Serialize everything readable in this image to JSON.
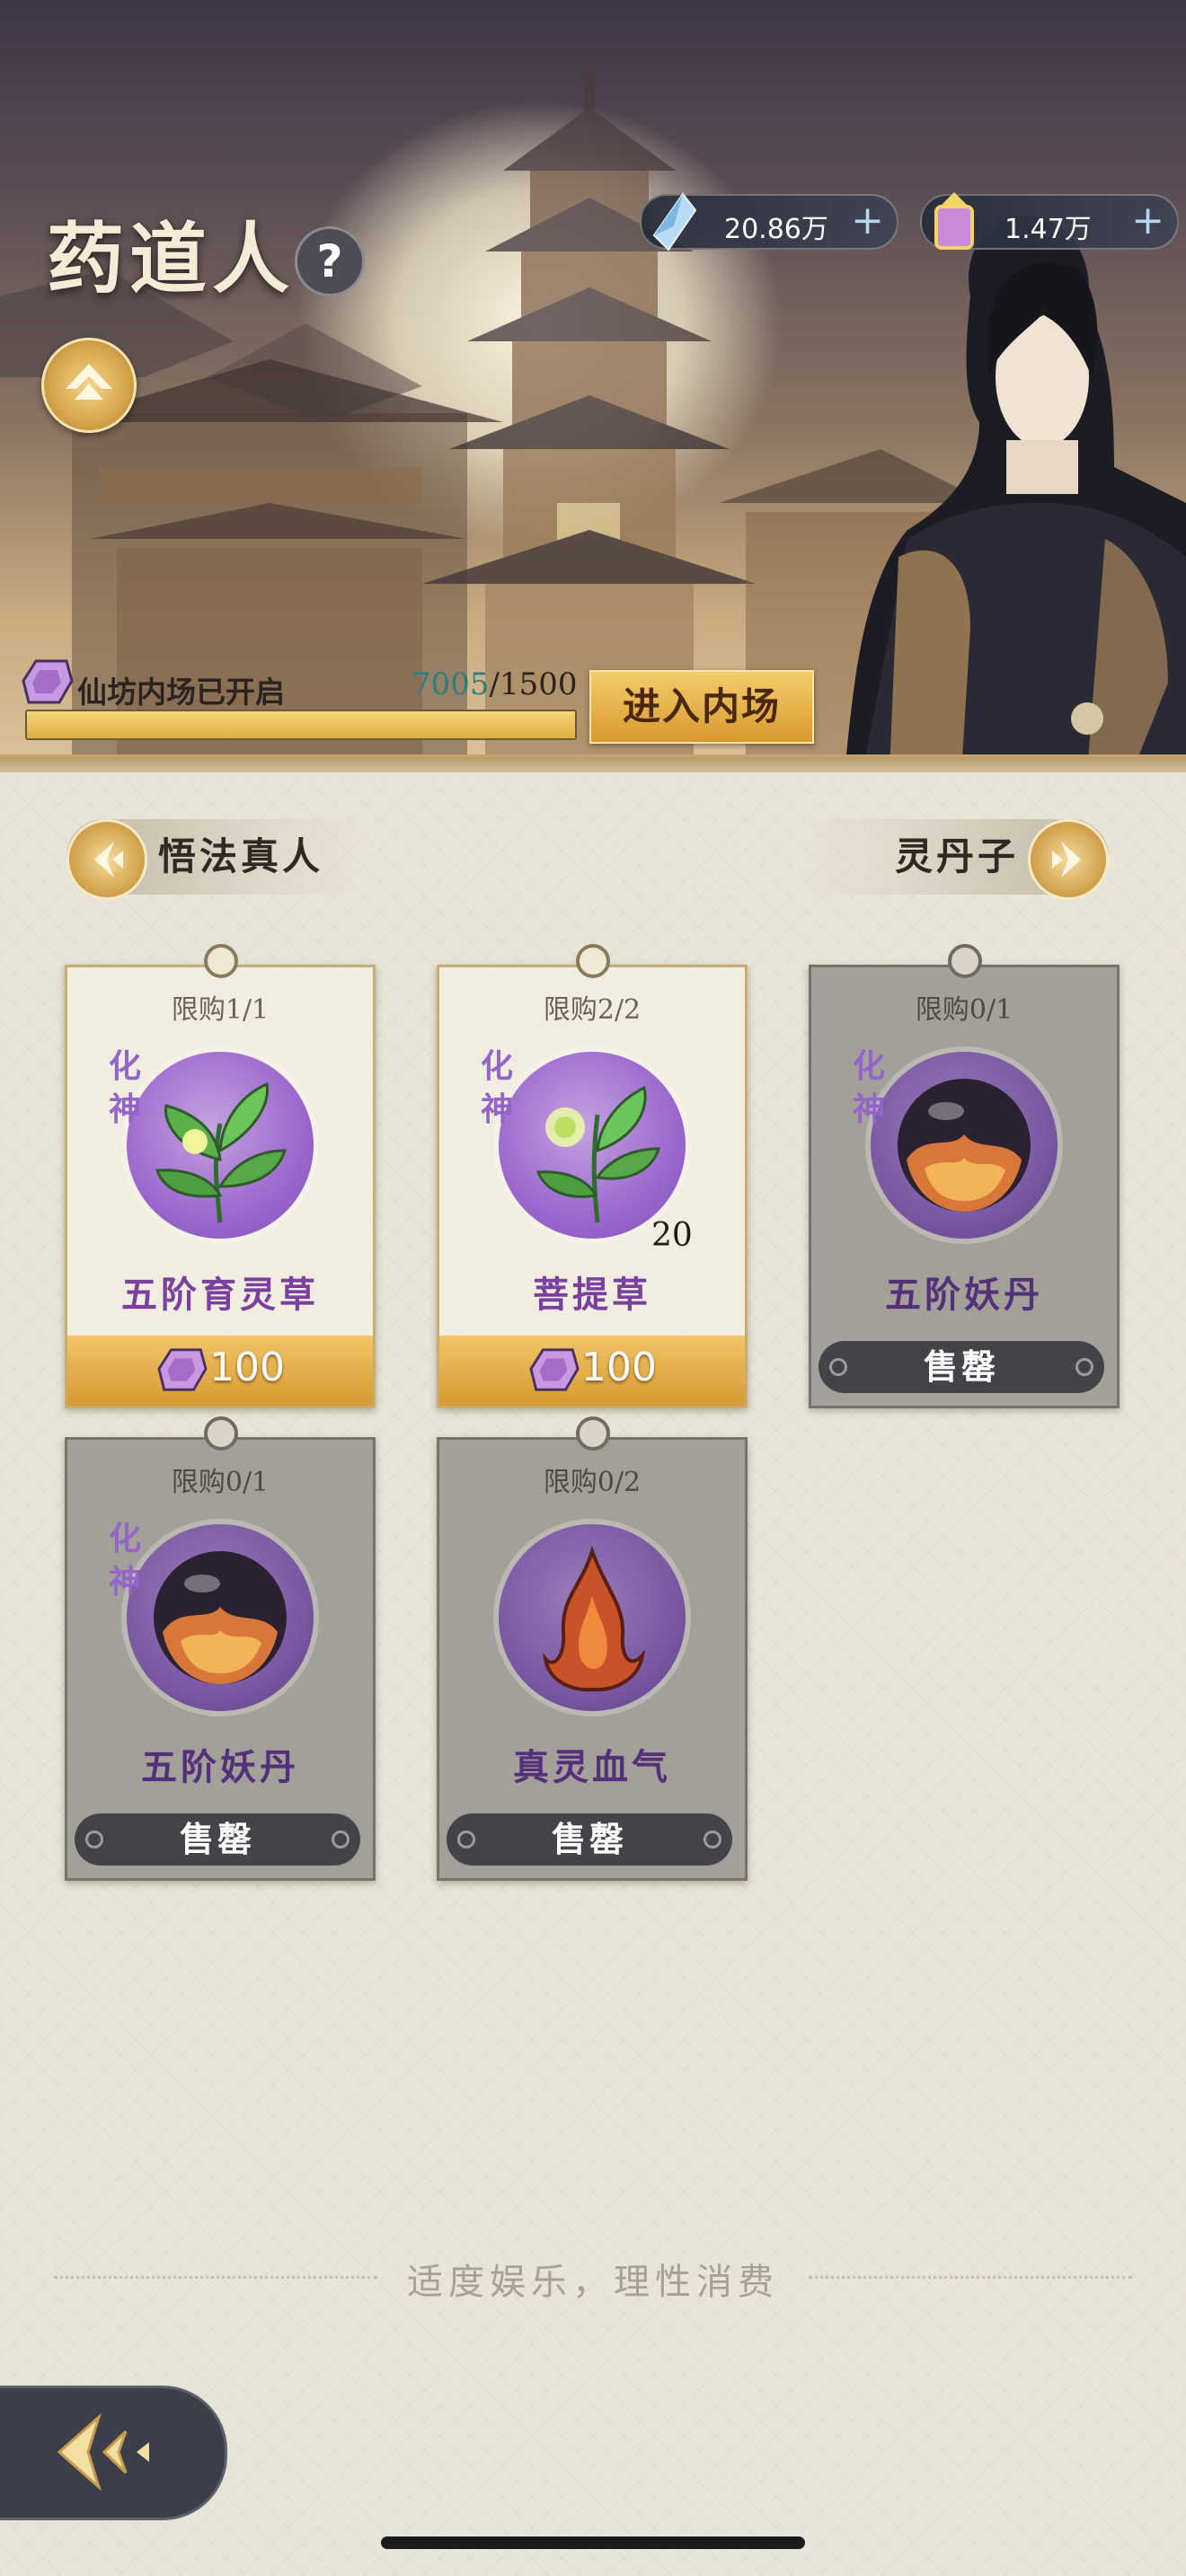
{
  "header": {
    "title": "药道人",
    "help_icon": "question-mark-icon",
    "rank_icon": "rank-up-icon",
    "currencies": [
      {
        "name": "spirit-crystal",
        "value": "20.86万",
        "icon": "crystal-icon"
      },
      {
        "name": "immortal-jade",
        "value": "1.47万",
        "icon": "jade-pouch-icon"
      }
    ],
    "progress": {
      "label": "仙坊内场已开启",
      "current": "7005",
      "total": "/1500",
      "fraction": 1.0
    },
    "enter_button": "进入内场"
  },
  "nav": {
    "prev_label": "悟法真人",
    "next_label": "灵丹子"
  },
  "items": [
    {
      "limit": "限购1/1",
      "realm_top": "化",
      "realm_bottom": "神",
      "name": "五阶育灵草",
      "price": "100",
      "sold_out": false,
      "qty": ""
    },
    {
      "limit": "限购2/2",
      "realm_top": "化",
      "realm_bottom": "神",
      "name": "菩提草",
      "price": "100",
      "sold_out": false,
      "qty": "20"
    },
    {
      "limit": "限购0/1",
      "realm_top": "化",
      "realm_bottom": "神",
      "name": "五阶妖丹",
      "sold_text": "售罄",
      "sold_out": true
    },
    {
      "limit": "限购0/1",
      "realm_top": "化",
      "realm_bottom": "神",
      "name": "五阶妖丹",
      "sold_text": "售罄",
      "sold_out": true
    },
    {
      "limit": "限购0/2",
      "realm_top": "",
      "realm_bottom": "",
      "name": "真灵血气",
      "sold_text": "售罄",
      "sold_out": true
    }
  ],
  "footer": {
    "note": "适度娱乐，理性消费"
  },
  "colors": {
    "gold": "#d9982f",
    "purple": "#9364c9",
    "teal": "#2f7d83"
  }
}
